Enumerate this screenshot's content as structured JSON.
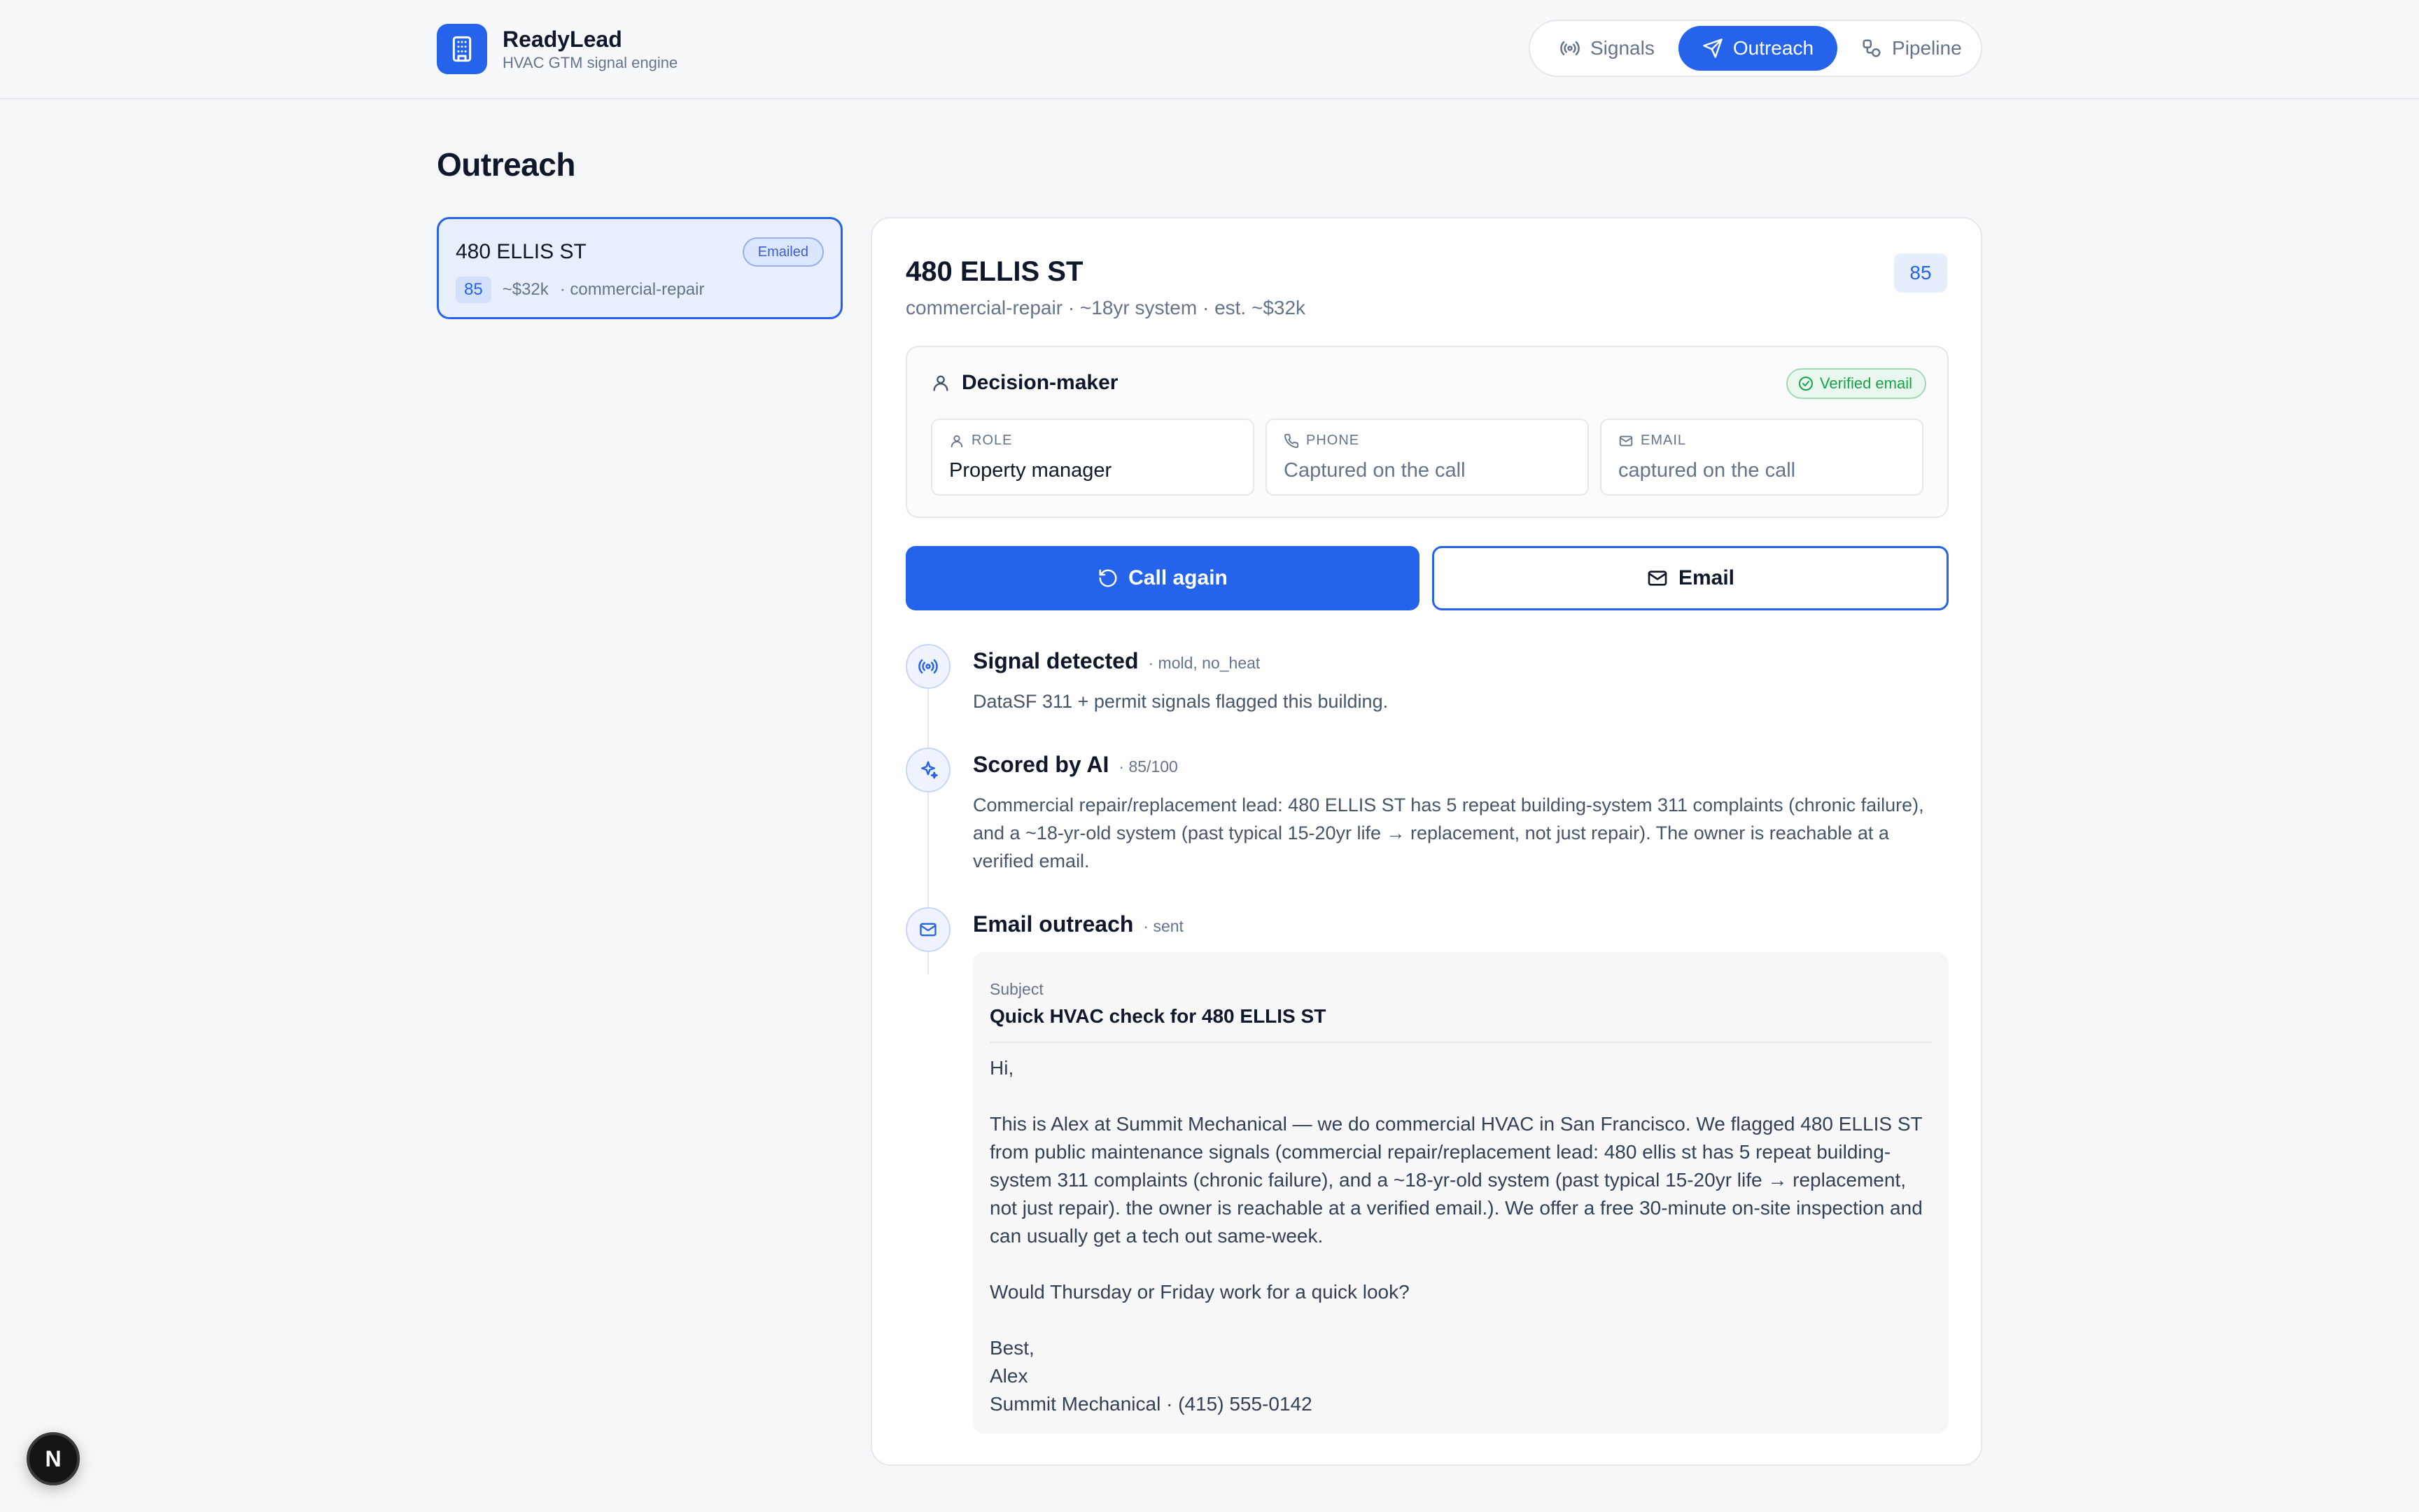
{
  "brand": {
    "name": "ReadyLead",
    "tagline": "HVAC GTM signal engine",
    "logo_icon": "building-icon"
  },
  "nav": {
    "items": [
      {
        "label": "Signals",
        "icon": "broadcast-icon",
        "active": false
      },
      {
        "label": "Outreach",
        "icon": "send-icon",
        "active": true
      },
      {
        "label": "Pipeline",
        "icon": "pipeline-icon",
        "active": false
      }
    ]
  },
  "page": {
    "title": "Outreach"
  },
  "lead_list": [
    {
      "name": "480 ELLIS ST",
      "status": "Emailed",
      "score": "85",
      "value": "~$32k",
      "category": "· commercial-repair"
    }
  ],
  "detail": {
    "title": "480 ELLIS ST",
    "subtitle": "commercial-repair · ~18yr system · est. ~$32k",
    "score": "85",
    "decision_maker": {
      "title": "Decision-maker",
      "verified": "Verified email",
      "role_label": "ROLE",
      "role_value": "Property manager",
      "phone_label": "PHONE",
      "phone_value": "Captured on the call",
      "email_label": "EMAIL",
      "email_value": "captured on the call"
    },
    "actions": {
      "call_again": "Call again",
      "email": "Email"
    },
    "timeline": [
      {
        "title": "Signal detected",
        "tag": "· mold, no_heat",
        "body": "DataSF 311 + permit signals flagged this building.",
        "icon": "broadcast-icon"
      },
      {
        "title": "Scored by AI",
        "tag": "· 85/100",
        "body": "Commercial repair/replacement lead: 480 ELLIS ST has 5 repeat building-system 311 complaints (chronic failure), and a ~18-yr-old system (past typical 15-20yr life → replacement, not just repair). The owner is reachable at a verified email.",
        "icon": "sparkle-icon"
      },
      {
        "title": "Email outreach",
        "tag": "· sent",
        "icon": "mail-icon",
        "email": {
          "subject_label": "Subject",
          "subject": "Quick HVAC check for 480 ELLIS ST",
          "greeting": "Hi,",
          "paragraph": "This is Alex at Summit Mechanical — we do commercial HVAC in San Francisco. We flagged 480 ELLIS ST from public maintenance signals (commercial repair/replacement lead: 480 ellis st has 5 repeat building-system 311 complaints (chronic failure), and a ~18-yr-old system (past typical 15-20yr life → replacement, not just repair). the owner is reachable at a verified email.). We offer a free 30-minute on-site inspection and can usually get a tech out same-week.",
          "question": "Would Thursday or Friday work for a quick look?",
          "signoff": "Best,",
          "signer": "Alex",
          "signature": "Summit Mechanical · (415) 555-0142"
        }
      }
    ]
  },
  "devtools": {
    "badge": "N"
  },
  "colors": {
    "accent": "#2563eb",
    "success": "#16a34a",
    "muted": "#64748b",
    "background": "#f5f6f8"
  }
}
